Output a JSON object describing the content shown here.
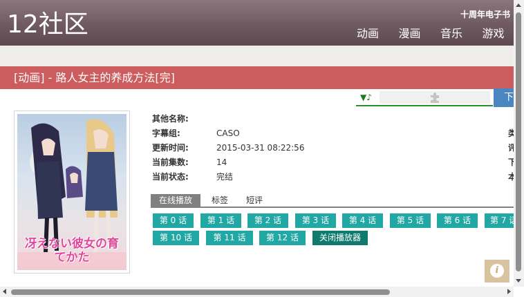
{
  "header": {
    "logo": "12社区",
    "ebook_link": "十周年电子书",
    "nav": [
      "动画",
      "漫画",
      "音乐",
      "游戏"
    ]
  },
  "title": "[动画] - 路人女主的养成方法[完]",
  "player": {
    "music_icon": "▼♪",
    "puzzle_icon": "puzzle-icon",
    "download_label": "下"
  },
  "poster": {
    "logo_text": "冴えない彼女の育てかた"
  },
  "info": {
    "rows": [
      {
        "label": "其他名称:",
        "value": ""
      },
      {
        "label": "字幕组:",
        "value": "CASO"
      },
      {
        "label": "更新时间:",
        "value": "2015-03-31 08:22:56"
      },
      {
        "label": "当前集数:",
        "value": "14"
      },
      {
        "label": "当前状态:",
        "value": "完结"
      }
    ],
    "right_cut": [
      "类",
      "评",
      "下",
      "本"
    ]
  },
  "tabs": [
    "在线播放",
    "标签",
    "短评"
  ],
  "episodes": [
    "第 0 话",
    "第 1 话",
    "第 2 话",
    "第 3 话",
    "第 4 话",
    "第 5 话",
    "第 6 话",
    "第 7 话",
    "第 10 话",
    "第 11 话",
    "第 12 话"
  ],
  "close_player": "关闭播放器",
  "info_button": "i",
  "colors": {
    "title_bar": "#cc5c5e",
    "episode_button": "#21a8a4",
    "close_button": "#0f7b6e",
    "tab_active": "#808080"
  }
}
